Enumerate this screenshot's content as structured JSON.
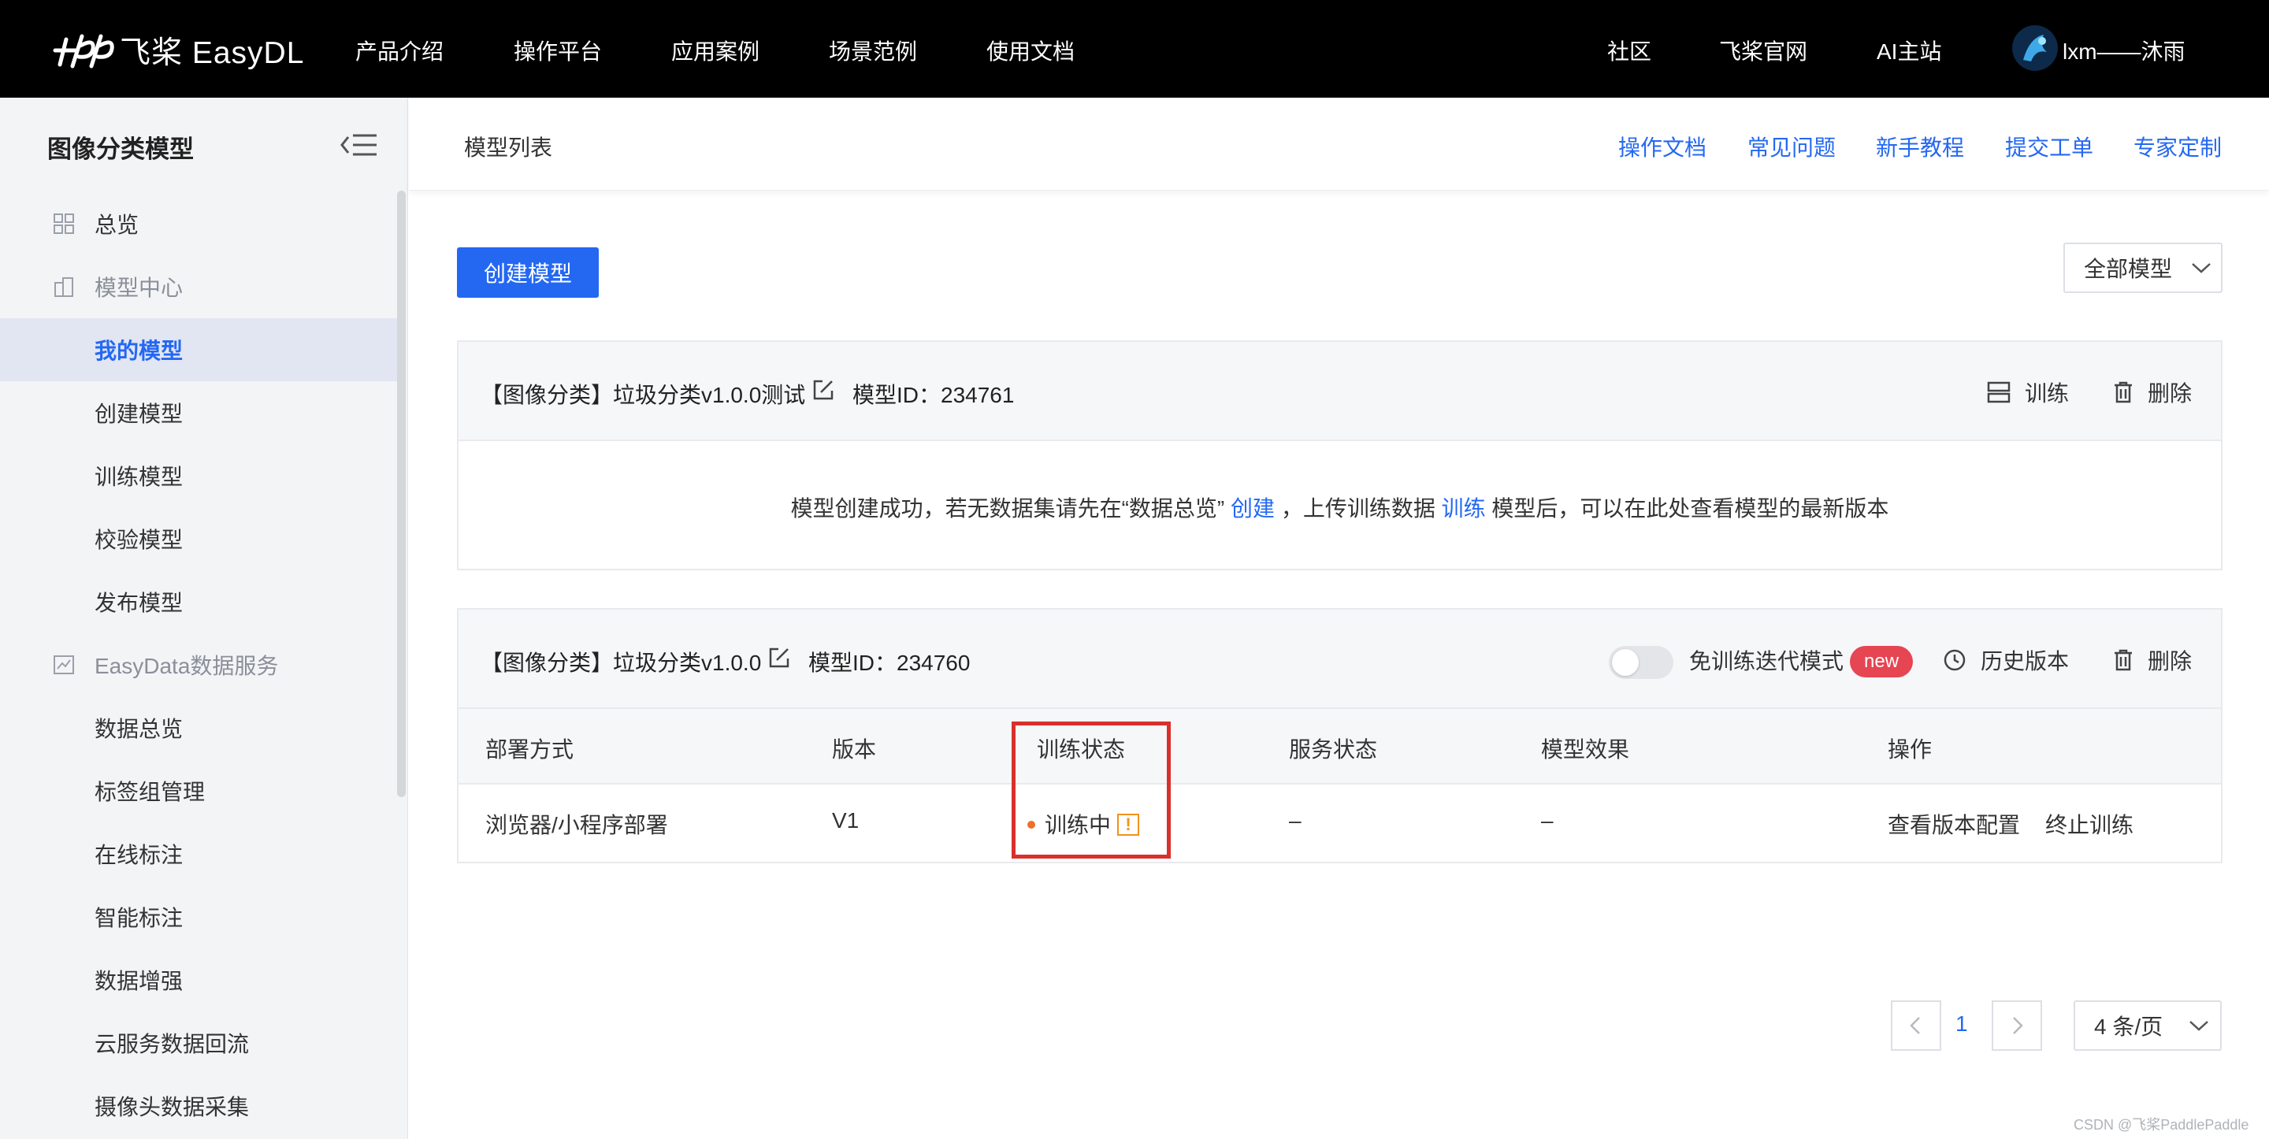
{
  "topbar": {
    "brand": "飞桨 EasyDL",
    "nav": [
      "产品介绍",
      "操作平台",
      "应用案例",
      "场景范例",
      "使用文档"
    ],
    "right_nav": [
      "社区",
      "飞桨官网",
      "AI主站"
    ],
    "user_name": "lxm——沐雨"
  },
  "sidebar": {
    "title": "图像分类模型",
    "overview": "总览",
    "model_center": "模型中心",
    "model_items": [
      "我的模型",
      "创建模型",
      "训练模型",
      "校验模型",
      "发布模型"
    ],
    "data_service": "EasyData数据服务",
    "data_items": [
      "数据总览",
      "标签组管理",
      "在线标注",
      "智能标注",
      "数据增强",
      "云服务数据回流",
      "摄像头数据采集"
    ]
  },
  "header": {
    "breadcrumb": "模型列表",
    "links": [
      "操作文档",
      "常见问题",
      "新手教程",
      "提交工单",
      "专家定制"
    ]
  },
  "toolbar": {
    "create_button": "创建模型",
    "filter_value": "全部模型"
  },
  "card1": {
    "title": "【图像分类】垃圾分类v1.0.0测试",
    "model_id": "模型ID：234761",
    "train_label": "训练",
    "delete_label": "删除",
    "msg_before": "模型创建成功，若无数据集请先在“数据总览”",
    "msg_link1": "创建",
    "msg_mid": "，上传训练数据",
    "msg_link2": "训练",
    "msg_after": "模型后，可以在此处查看模型的最新版本"
  },
  "card2": {
    "title": "【图像分类】垃圾分类v1.0.0",
    "model_id": "模型ID：234760",
    "toggle_label": "免训练迭代模式",
    "toggle_on": false,
    "new_badge": "new",
    "history_label": "历史版本",
    "delete_label": "删除",
    "columns": [
      "部署方式",
      "版本",
      "训练状态",
      "服务状态",
      "模型效果",
      "操作"
    ],
    "row": {
      "deploy": "浏览器/小程序部署",
      "version": "V1",
      "train_status": "训练中",
      "warn": "!",
      "service_status": "–",
      "effect": "–",
      "action_view": "查看版本配置",
      "action_stop": "终止训练"
    }
  },
  "pagination": {
    "current_page": "1",
    "page_size": "4 条/页"
  },
  "watermark": "CSDN @飞桨PaddlePaddle",
  "colors": {
    "accent": "#2468f2",
    "topbar": "#000000",
    "badge": "#e64552",
    "highlight": "#d9302c",
    "status_dot": "#f0702a"
  }
}
